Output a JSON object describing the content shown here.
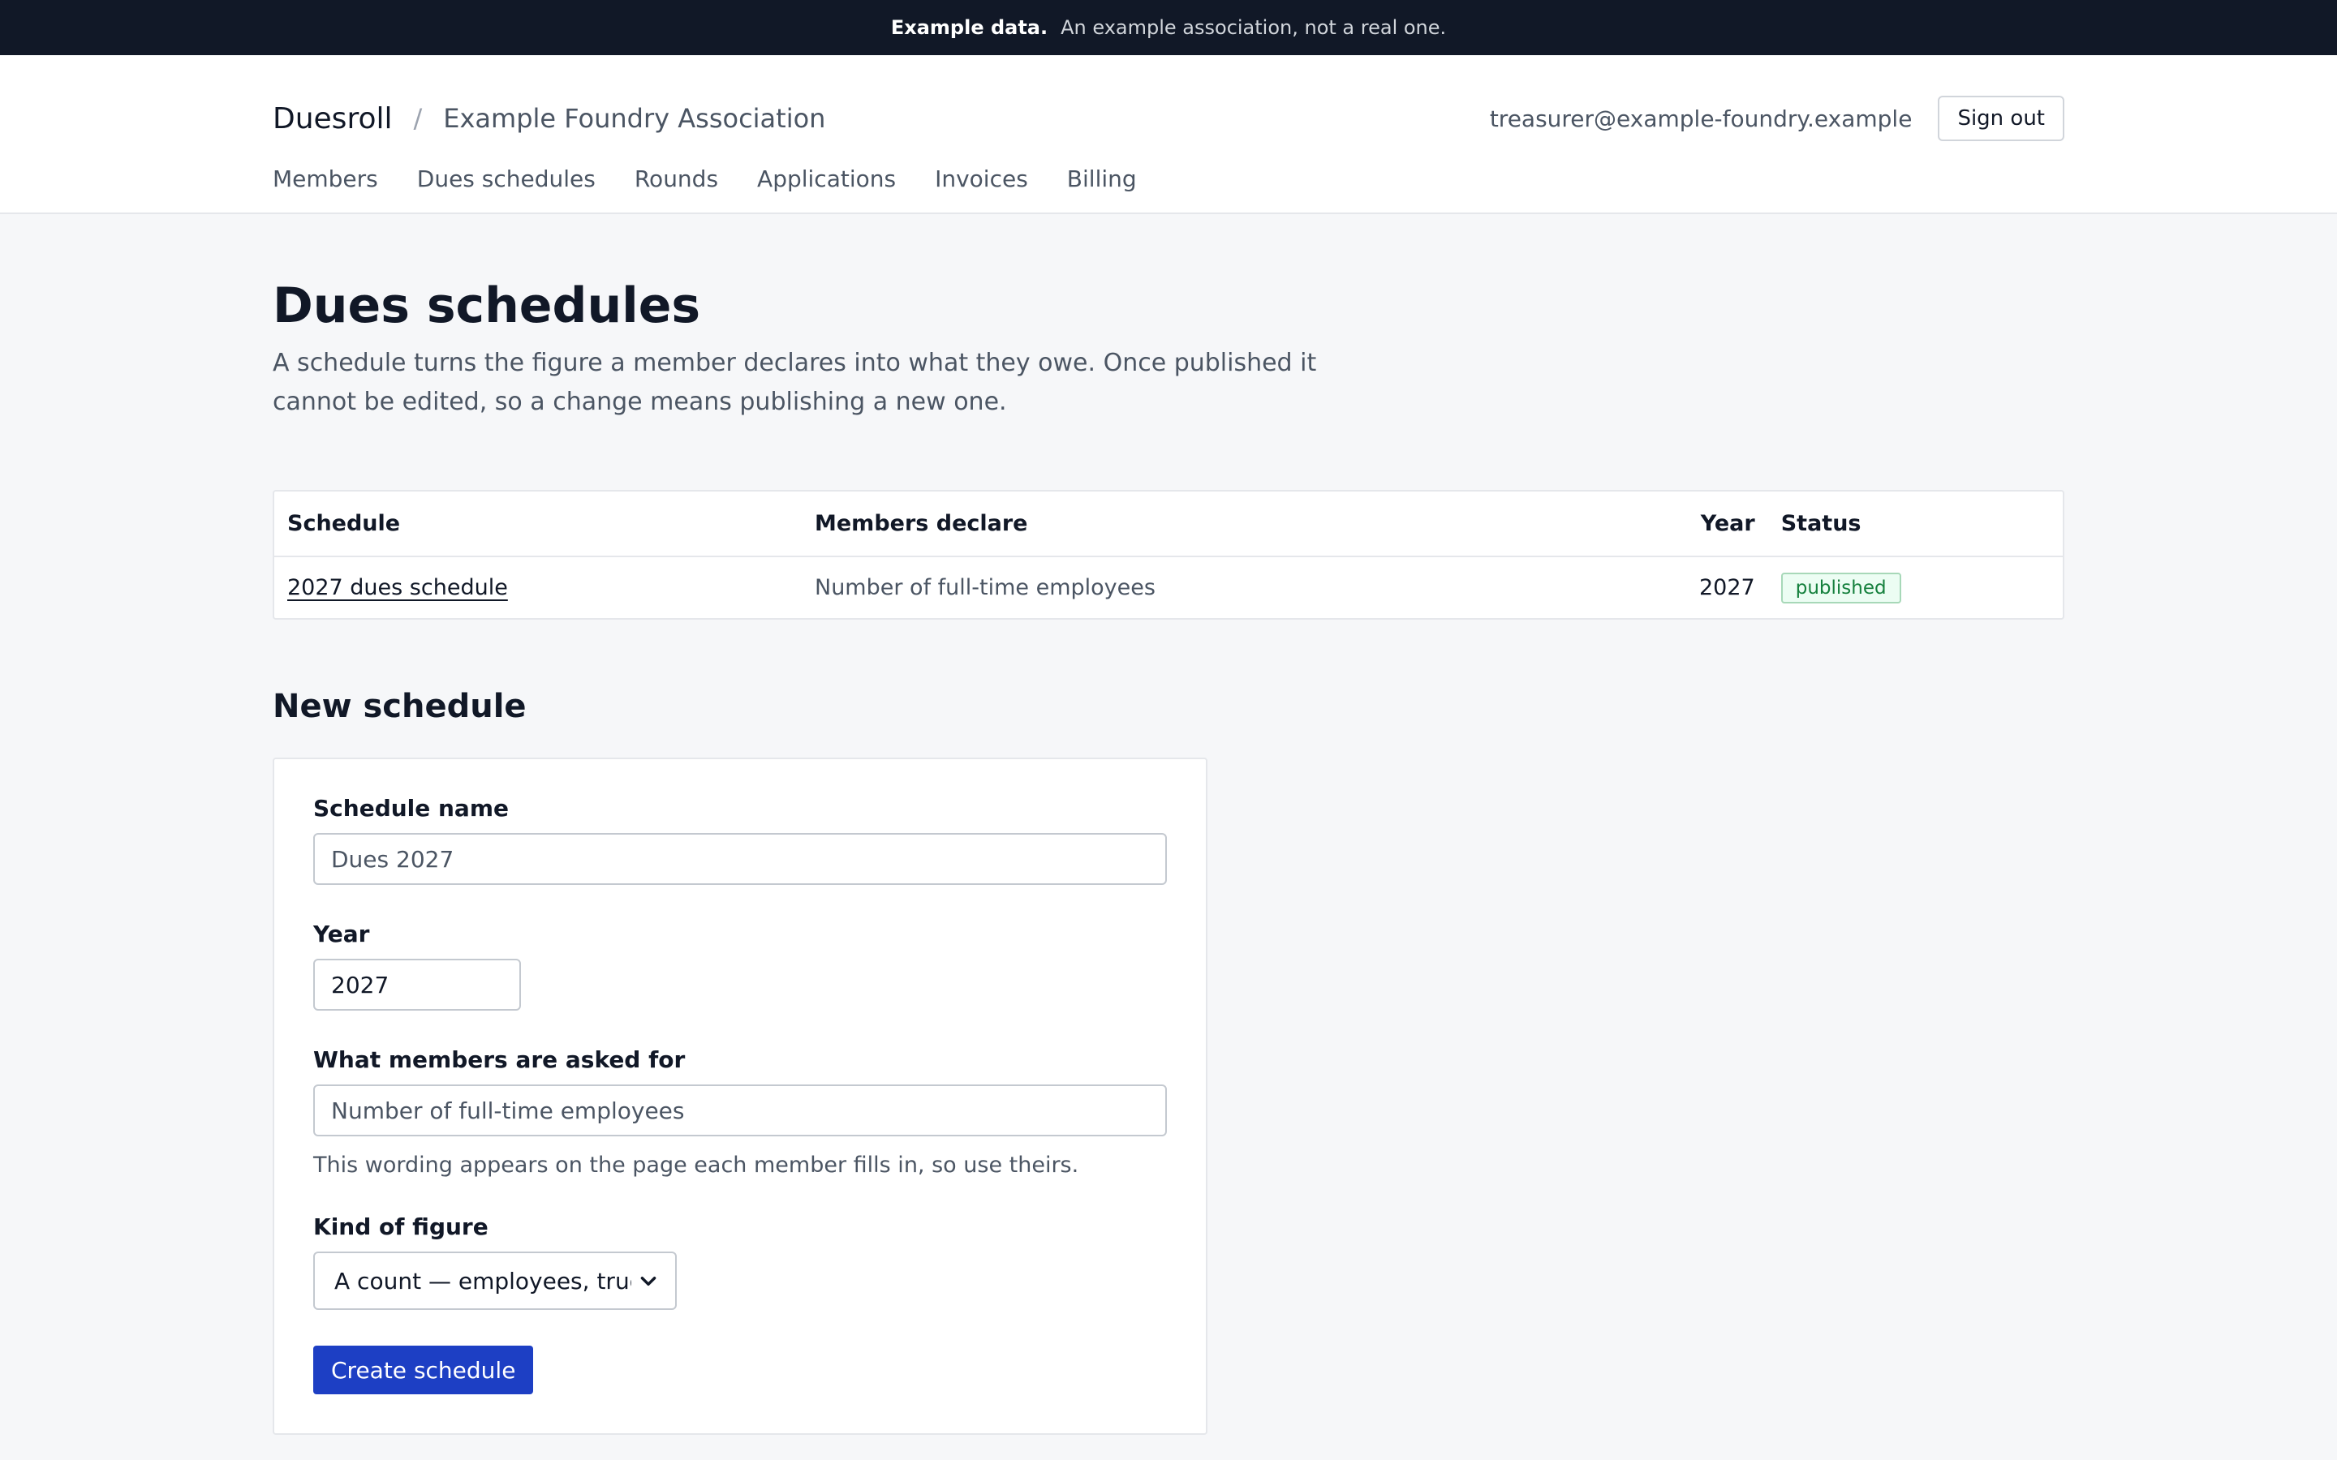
{
  "banner": {
    "strong": "Example data.",
    "text": "An example association, not a real one."
  },
  "header": {
    "brand": "Duesroll",
    "separator": "/",
    "org": "Example Foundry Association",
    "user_email": "treasurer@example-foundry.example",
    "sign_out": "Sign out"
  },
  "nav": {
    "items": [
      {
        "label": "Members"
      },
      {
        "label": "Dues schedules"
      },
      {
        "label": "Rounds"
      },
      {
        "label": "Applications"
      },
      {
        "label": "Invoices"
      },
      {
        "label": "Billing"
      }
    ]
  },
  "page": {
    "title": "Dues schedules",
    "description": "A schedule turns the figure a member declares into what they owe. Once published it cannot be edited, so a change means publishing a new one."
  },
  "table": {
    "headers": {
      "schedule": "Schedule",
      "declare": "Members declare",
      "year": "Year",
      "status": "Status"
    },
    "rows": [
      {
        "schedule": "2027 dues schedule",
        "declare": "Number of full-time employees",
        "year": "2027",
        "status": "published"
      }
    ]
  },
  "form": {
    "section_title": "New schedule",
    "name_label": "Schedule name",
    "name_placeholder": "Dues 2027",
    "year_label": "Year",
    "year_value": "2027",
    "asked_label": "What members are asked for",
    "asked_placeholder": "Number of full-time employees",
    "asked_help": "This wording appears on the page each member fills in, so use theirs.",
    "kind_label": "Kind of figure",
    "kind_selected": "A count — employees, trucks,",
    "submit": "Create schedule"
  },
  "colors": {
    "primary": "#1d3fc4",
    "banner_bg": "#111827",
    "badge_green": "#15803d"
  },
  "icons": {
    "select": "chevron-down-icon"
  }
}
